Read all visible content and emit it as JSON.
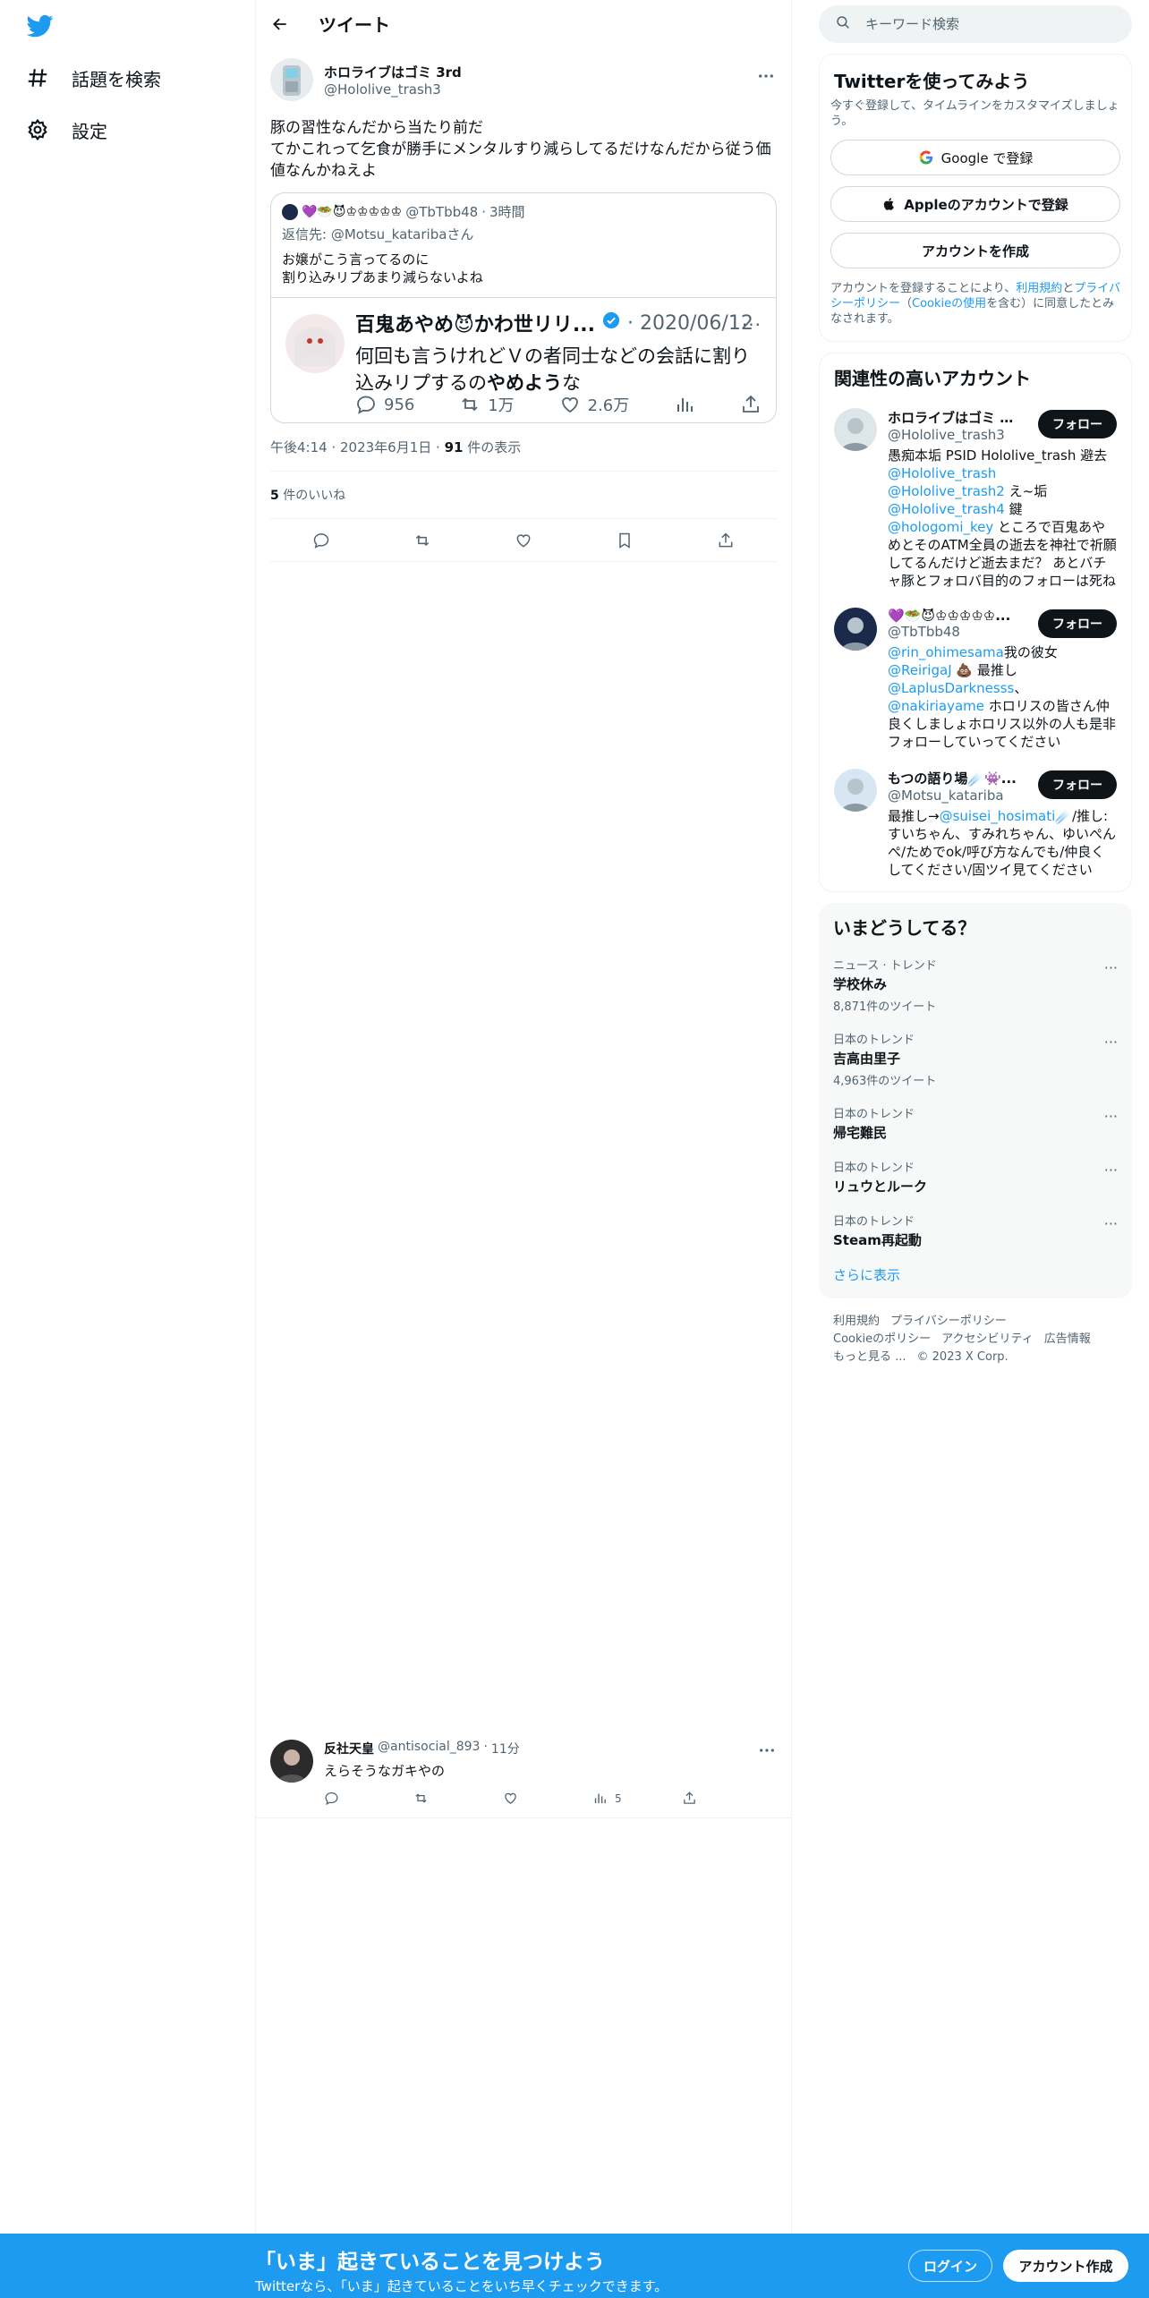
{
  "nav": {
    "explore_label": "話題を検索",
    "settings_label": "設定"
  },
  "header": {
    "title": "ツイート"
  },
  "tweet": {
    "author_name": "ホロライブはゴミ 3rd",
    "author_handle": "@Hololive_trash3",
    "text": "豚の習性なんだから当たり前だ\nてかこれって乞食が勝手にメンタルすり減らしてるだけなんだから従う価値なんかねえよ",
    "quote": {
      "author_name": "♔♔♔♔♔",
      "author_handle": "@TbTbb48",
      "time": "3時間",
      "reply_to_label": "返信先:",
      "reply_to_handle": "@Motsu_katariba",
      "reply_to_suffix": "さん",
      "text": "お嬢がこう言ってるのに\n割り込みリプあまり減らないよね",
      "embedded": {
        "name": "百鬼あやめ😈かわ世リリ...",
        "date": "2020/06/12",
        "text_pre": "何回も言うけれどＶの者同士などの会話に割り込みリプするの",
        "text_bold": "やめよう",
        "text_post": "な",
        "replies": "956",
        "retweets": "1万",
        "likes": "2.6万"
      }
    },
    "time": "午後4:14",
    "date": "2023年6月1日",
    "views": "91",
    "views_label": "件の表示",
    "likes_count": "5",
    "likes_label": "件のいいね"
  },
  "reply": {
    "name": "反社天皇",
    "handle": "@antisocial_893",
    "time": "11分",
    "text": "えらそうなガキやの",
    "views": "5"
  },
  "search": {
    "placeholder": "キーワード検索"
  },
  "signup": {
    "title": "Twitterを使ってみよう",
    "subtitle": "今すぐ登録して、タイムラインをカスタマイズしましょう。",
    "google": "Google で登録",
    "apple": "Appleのアカウントで登録",
    "create": "アカウントを作成",
    "terms_pre": "アカウントを登録することにより、",
    "terms_link1": "利用規約",
    "terms_mid1": "と",
    "terms_link2": "プライバシーポリシー",
    "terms_mid2": "（",
    "terms_link3": "Cookieの使用",
    "terms_post": "を含む）に同意したとみなされます。"
  },
  "related": {
    "title": "関連性の高いアカウント",
    "follow_label": "フォロー",
    "users": [
      {
        "name": "ホロライブはゴミ 3rd",
        "handle": "@Hololive_trash3",
        "bio_html": "愚痴本垢 PSID Hololive_trash 避去<span class=\"blue\">@Hololive_trash</span> <span class=\"blue\">@Hololive_trash2</span> え~垢 <span class=\"blue\">@Hololive_trash4</span> 鍵 <span class=\"blue\">@hologomi_key</span> ところで百鬼あやめとそのATM全員の逝去を神社で祈願してるんだけど逝去まだ？ あとバチャ豚とフォロバ目的のフォローは死ね"
      },
      {
        "name": "💜🥗😈♔♔♔♔♔...",
        "handle": "@TbTbb48",
        "bio_html": "<span class=\"blue\">@rin_ohimesama</span>我の彼女 <span class=\"blue\">@ReirigaJ</span> 💩 最推し <span class=\"blue\">@LaplusDarknesss</span>、<span class=\"blue\">@nakiriayame</span> ホロリスの皆さん仲良くしましょホロリス以外の人も是非フォローしていってください"
      },
      {
        "name": "もつの語り場☄️👾...",
        "handle": "@Motsu_katariba",
        "bio_html": "最推し→<span class=\"blue\">@suisei_hosimati</span>☄️/推し:すいちゃん、すみれちゃん、ゆいぺんぺ/ためでok/呼び方なんでも/仲良くしてください/固ツイ見てください"
      }
    ]
  },
  "trends": {
    "title": "いまどうしてる？",
    "items": [
      {
        "context": "ニュース · トレンド",
        "name": "学校休み",
        "count": "8,871件のツイート"
      },
      {
        "context": "日本のトレンド",
        "name": "吉高由里子",
        "count": "4,963件のツイート"
      },
      {
        "context": "日本のトレンド",
        "name": "帰宅難民",
        "count": ""
      },
      {
        "context": "日本のトレンド",
        "name": "リュウとルーク",
        "count": ""
      },
      {
        "context": "日本のトレンド",
        "name": "Steam再起動",
        "count": ""
      }
    ],
    "show_more": "さらに表示"
  },
  "footer": {
    "terms": "利用規約",
    "privacy": "プライバシーポリシー",
    "cookie": "Cookieのポリシー",
    "accessibility": "アクセシビリティ",
    "ads": "広告情報",
    "more": "もっと見る ...",
    "copyright": "© 2023 X Corp."
  },
  "bottom_bar": {
    "title": "「いま」起きていることを見つけよう",
    "subtitle": "Twitterなら、「いま」起きていることをいち早くチェックできます。",
    "login": "ログイン",
    "signup": "アカウント作成"
  },
  "colors": {
    "accent": "#1d9bf0",
    "text": "#0f1419",
    "muted": "#536471"
  }
}
